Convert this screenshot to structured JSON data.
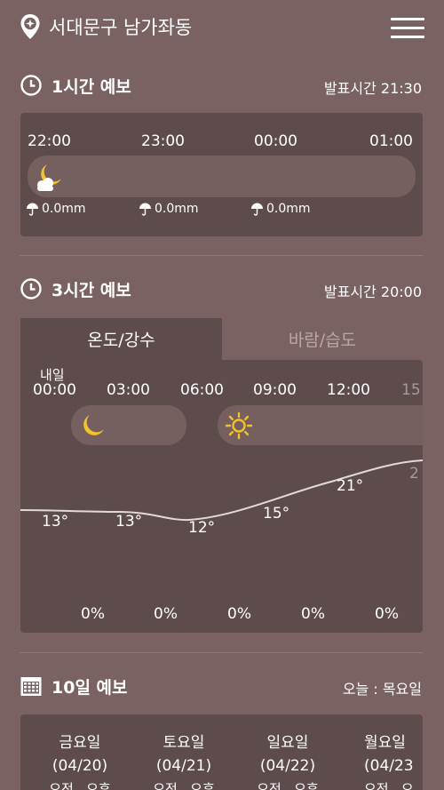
{
  "header": {
    "location": "서대문구 남가좌동"
  },
  "hourly": {
    "title": "1시간 예보",
    "issued": "발표시간 21:30",
    "times": [
      "22:00",
      "23:00",
      "00:00",
      "01:00"
    ],
    "rain": [
      "0.0mm",
      "0.0mm",
      "0.0mm"
    ]
  },
  "three_hour": {
    "title": "3시간 예보",
    "issued": "발표시간 20:00",
    "tabs": [
      "온도/강수",
      "바람/습도"
    ],
    "tomorrow_label": "내일",
    "times": [
      "00:00",
      "03:00",
      "06:00",
      "09:00",
      "12:00",
      "15"
    ],
    "temps": [
      "13°",
      "13°",
      "12°",
      "15°",
      "21°",
      "2"
    ],
    "precip": [
      "0%",
      "0%",
      "0%",
      "0%",
      "0%"
    ]
  },
  "ten_day": {
    "title": "10일 예보",
    "today": "오늘 : 목요일",
    "days": [
      {
        "name": "금요일",
        "date": "(04/20)",
        "am": "오전",
        "pm": "오후"
      },
      {
        "name": "토요일",
        "date": "(04/21)",
        "am": "오전",
        "pm": "오후"
      },
      {
        "name": "일요일",
        "date": "(04/22)",
        "am": "오전",
        "pm": "오후"
      },
      {
        "name": "월요일",
        "date": "(04/23",
        "am": "오전",
        "pm": "오"
      }
    ]
  },
  "colors": {
    "background": "#7a6262",
    "panel": "#5e4c4d",
    "moon": "#f2c22b"
  }
}
